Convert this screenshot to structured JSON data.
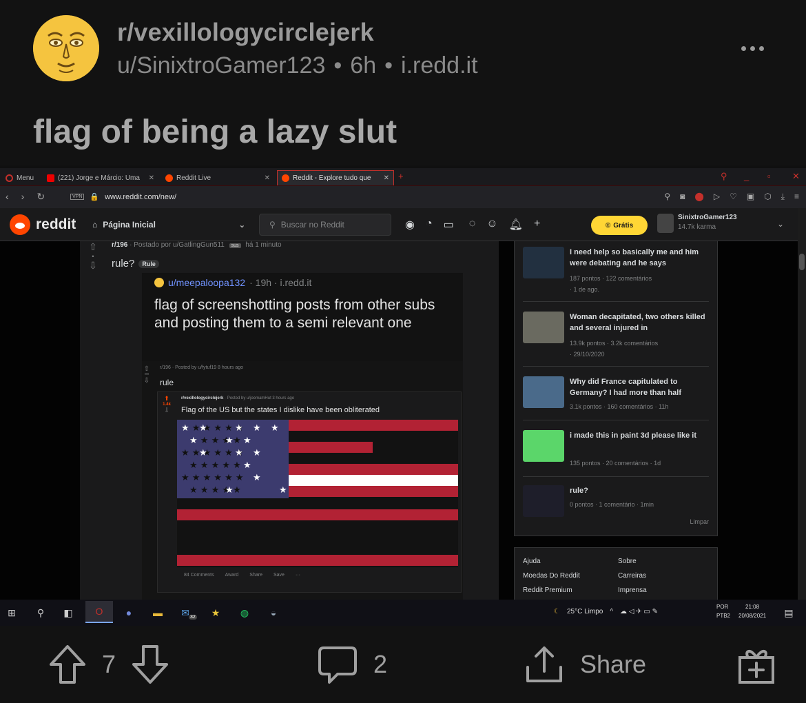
{
  "post": {
    "subreddit": "r/vexillologycirclejerk",
    "author": "u/SinixtroGamer123",
    "age": "6h",
    "domain": "i.redd.it",
    "title": "flag of being a lazy slut"
  },
  "browser": {
    "tabs": [
      {
        "label": "Menu"
      },
      {
        "label": "(221) Jorge e Márcio: Uma"
      },
      {
        "label": "Reddit Live"
      },
      {
        "label": "Reddit - Explore tudo que"
      }
    ],
    "url": "www.reddit.com/new/",
    "vpn": "VPN"
  },
  "reddit_bar": {
    "logo_text": "reddit",
    "home_label": "Página Inicial",
    "search_placeholder": "Buscar no Reddit",
    "gratis_label": "Grátis",
    "username": "SinixtroGamer123",
    "karma": "14.7k karma"
  },
  "inner_post": {
    "crumb_sub": "r/196",
    "crumb_text": "· Postado por u/GatlingGun511",
    "crumb_badge": "sus",
    "crumb_time": "há 1 minuto",
    "title": "rule?",
    "flair": "Rule"
  },
  "nested1": {
    "user": "u/meepaloopa132",
    "time": "· 19h · i.redd.it",
    "title": "flag of screenshotting posts from other subs and posting them to a semi relevant one"
  },
  "nested2": {
    "meta": "r/196 · Posted by u/fytuf19 8 hours ago",
    "title": "rule"
  },
  "nested3": {
    "votes": "1.4k",
    "sub": "r/vexillologycirclejerk",
    "meta": "· Posted by u/joemamHut 3 hours ago",
    "title": "Flag of the US but the states I dislike have been obliterated",
    "actions": [
      "84 Comments",
      "Award",
      "Share",
      "Save",
      "···"
    ]
  },
  "sidebar": {
    "items": [
      {
        "title": "I need help so basically me and him were debating and he says",
        "stats": "187 pontos · 122 comentários",
        "stats2": "· 1 de ago."
      },
      {
        "title": "Woman decapitated, two others killed and several injured in",
        "stats": "13.9k pontos · 3.2k comentários",
        "stats2": "· 29/10/2020"
      },
      {
        "title": "Why did France capitulated to Germany? I had more than half",
        "stats": "3.1k pontos · 160 comentários · 11h",
        "stats2": ""
      },
      {
        "title": "i made this in paint 3d please like it",
        "stats": "135 pontos · 20 comentários · 1d",
        "stats2": ""
      },
      {
        "title": "rule?",
        "stats": "0 pontos · 1 comentário · 1min",
        "stats2": ""
      }
    ],
    "clear_label": "Limpar",
    "links": [
      "Ajuda",
      "Moedas Do Reddit",
      "Reddit Premium",
      "Sobre",
      "Carreiras",
      "Imprensa"
    ]
  },
  "taskbar": {
    "weather": "25°C Limpo",
    "lang": "POR",
    "layout": "PTB2",
    "time": "21:08",
    "date": "20/08/2021",
    "badge": "32"
  },
  "actions": {
    "upvotes": "7",
    "comments": "2",
    "share_label": "Share"
  },
  "colors": {
    "reddit_orange": "#ff4500",
    "flag_red": "#b22234",
    "flag_blue": "#3c3b6e",
    "gratis_yellow": "#ffd635"
  }
}
